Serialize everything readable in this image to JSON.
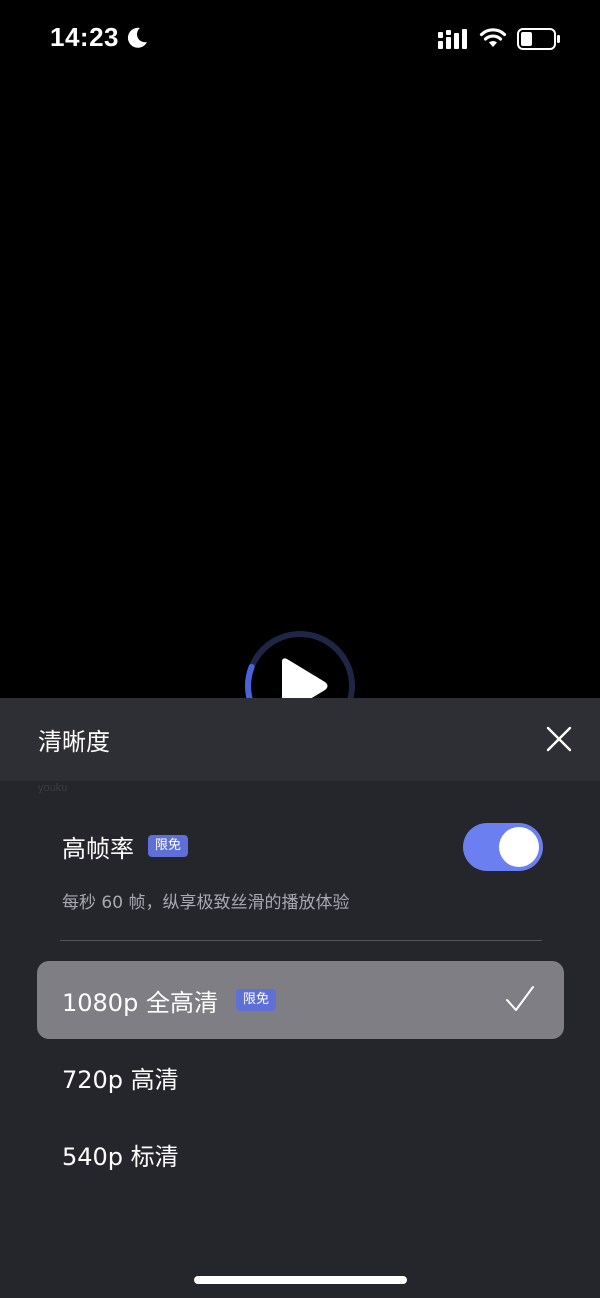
{
  "status_bar": {
    "time": "14:23",
    "icons": [
      "moon-icon",
      "cellular-signal-icon",
      "wifi-icon",
      "battery-icon"
    ]
  },
  "player": {
    "icon": "play-icon",
    "loading_progress": 0.25,
    "accent_color": "#4a63d8"
  },
  "sheet": {
    "title": "清晰度",
    "watermark": "youku",
    "high_frame_rate": {
      "label": "高帧率",
      "badge": "限免",
      "enabled": true,
      "description": "每秒 60 帧，纵享极致丝滑的播放体验"
    },
    "options": [
      {
        "label": "1080p 全高清",
        "badge": "限免",
        "selected": true
      },
      {
        "label": "720p 高清",
        "selected": false
      },
      {
        "label": "540p 标清",
        "selected": false
      }
    ]
  },
  "colors": {
    "sheet_bg": "#25252c",
    "header_bg": "#2e2e35",
    "badge": "#5e6fd8",
    "toggle_on": "#6c7ff0",
    "selected_row": "#7e7e84"
  }
}
